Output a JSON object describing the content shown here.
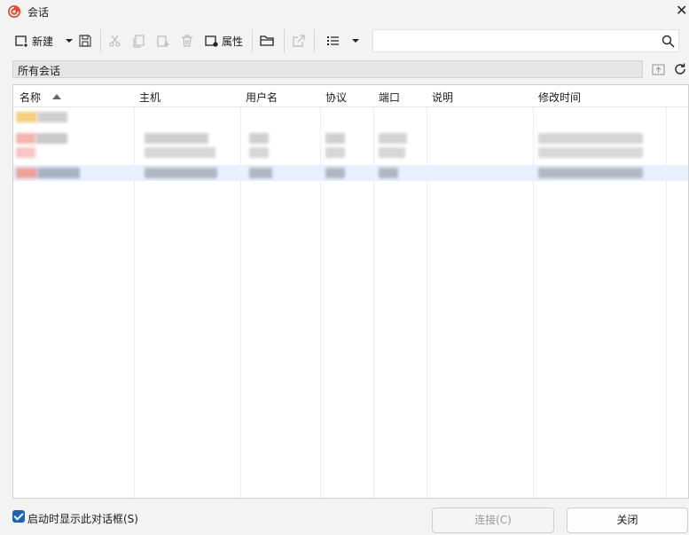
{
  "window": {
    "title": "会话",
    "close_glyph": "✕",
    "app_icon": "app-swirl-icon",
    "accent_color": "#e84a2f"
  },
  "toolbar": {
    "new_label": "新建",
    "properties_label": "属性",
    "search_placeholder": ""
  },
  "folder": {
    "path_label": "所有会话"
  },
  "table": {
    "columns": [
      "名称",
      "主机",
      "用户名",
      "协议",
      "端口",
      "说明",
      "修改时间"
    ],
    "sort_column": "名称",
    "sort_direction": "ascending"
  },
  "footer": {
    "show_on_startup_label": "启动时显示此对话框(S)",
    "show_on_startup_checked": true,
    "connect_label": "连接(C)",
    "close_label": "关闭"
  }
}
